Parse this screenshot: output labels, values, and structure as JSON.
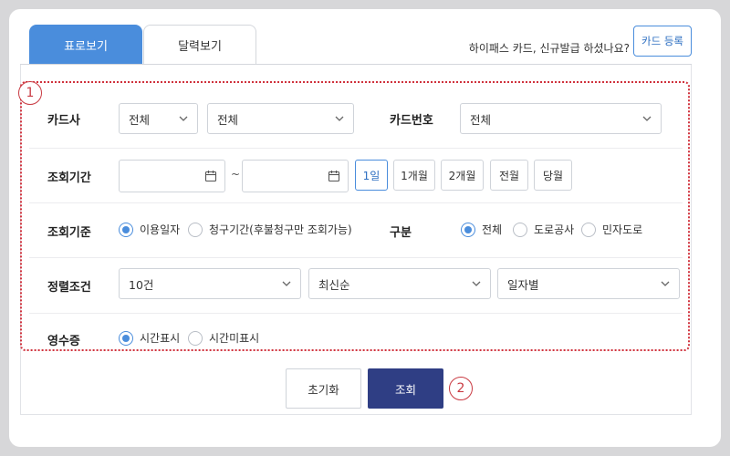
{
  "tabs": [
    {
      "label": "표로보기",
      "active": true
    },
    {
      "label": "달력보기",
      "active": false
    }
  ],
  "notice": "하이패스 카드, 신규발급 하셨나요?",
  "card_register_button": "카드 등록",
  "callouts": [
    "1",
    "2"
  ],
  "form": {
    "card_company": {
      "label": "카드사",
      "select1": "전체",
      "select2": "전체"
    },
    "card_number": {
      "label": "카드번호",
      "select": "전체"
    },
    "period": {
      "label": "조회기간",
      "start_value": "",
      "end_value": "",
      "separator": "~",
      "buttons": [
        "1일",
        "1개월",
        "2개월",
        "전월",
        "당월"
      ],
      "selected": "1일"
    },
    "criteria": {
      "label": "조회기준",
      "options": [
        "이용일자",
        "청구기간(후불청구만 조회가능)"
      ],
      "selected": "이용일자"
    },
    "category": {
      "label": "구분",
      "options": [
        "전체",
        "도로공사",
        "민자도로"
      ],
      "selected": "전체"
    },
    "sort": {
      "label": "정렬조건",
      "count": "10건",
      "order": "최신순",
      "grouping": "일자별"
    },
    "receipt": {
      "label": "영수증",
      "options": [
        "시간표시",
        "시간미표시"
      ],
      "selected": "시간표시"
    }
  },
  "actions": {
    "reset": "초기화",
    "search": "조회"
  },
  "colors": {
    "primary": "#4a8ddc",
    "search_button": "#2f3e84",
    "annotation": "#d0323d"
  }
}
